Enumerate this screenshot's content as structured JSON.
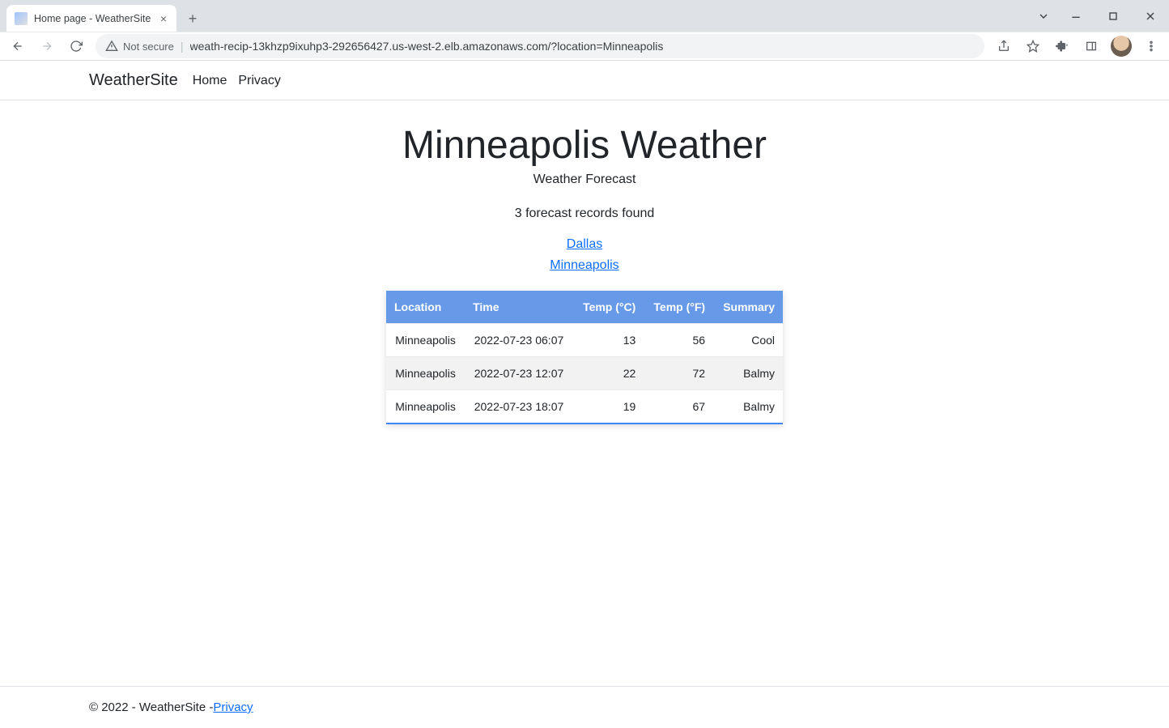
{
  "browser": {
    "tab_title": "Home page - WeatherSite",
    "not_secure": "Not secure",
    "url": "weath-recip-13khzp9ixuhp3-292656427.us-west-2.elb.amazonaws.com/?location=Minneapolis"
  },
  "navbar": {
    "brand": "WeatherSite",
    "links": [
      "Home",
      "Privacy"
    ]
  },
  "main": {
    "heading": "Minneapolis Weather",
    "subtitle": "Weather Forecast",
    "records_found": "3 forecast records found",
    "location_links": [
      "Dallas",
      "Minneapolis"
    ]
  },
  "table": {
    "headers": [
      "Location",
      "Time",
      "Temp (°C)",
      "Temp (°F)",
      "Summary"
    ],
    "rows": [
      {
        "location": "Minneapolis",
        "time": "2022-07-23 06:07",
        "c": "13",
        "f": "56",
        "summary": "Cool"
      },
      {
        "location": "Minneapolis",
        "time": "2022-07-23 12:07",
        "c": "22",
        "f": "72",
        "summary": "Balmy"
      },
      {
        "location": "Minneapolis",
        "time": "2022-07-23 18:07",
        "c": "19",
        "f": "67",
        "summary": "Balmy"
      }
    ]
  },
  "footer": {
    "text": "© 2022 - WeatherSite - ",
    "privacy": "Privacy"
  }
}
